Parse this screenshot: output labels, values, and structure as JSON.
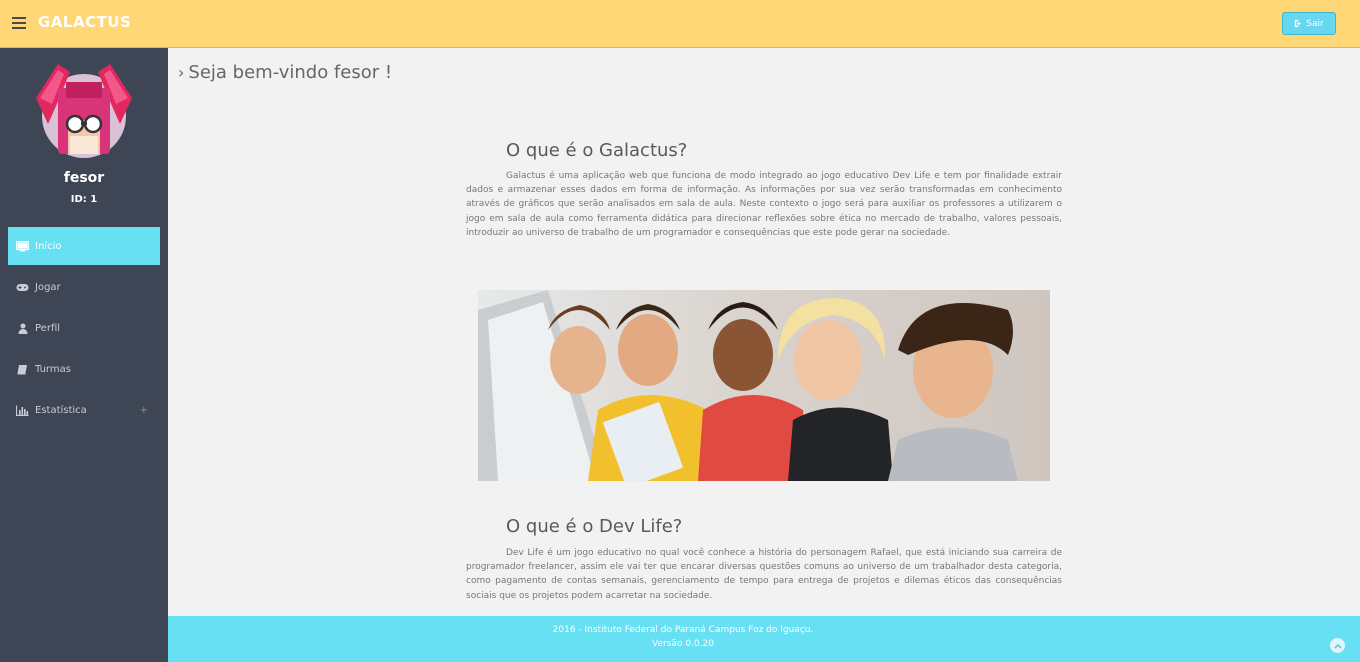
{
  "header": {
    "brand": "GALACTUS",
    "logout_label": "Sair",
    "accent": "#ffd776",
    "button_color": "#66d7ee"
  },
  "sidebar": {
    "username": "fesor",
    "user_id": "ID: 1",
    "items": [
      {
        "label": "Início",
        "icon": "monitor-icon",
        "active": true
      },
      {
        "label": "Jogar",
        "icon": "gamepad-icon"
      },
      {
        "label": "Perfil",
        "icon": "user-icon"
      },
      {
        "label": "Turmas",
        "icon": "book-icon"
      },
      {
        "label": "Estatística",
        "icon": "bar-chart-icon",
        "expand": "+"
      }
    ],
    "background": "#3e4555",
    "active_color": "#66e0f2"
  },
  "main": {
    "welcome": "Seja bem-vindo fesor !",
    "sections": [
      {
        "title": "O que é o Galactus?",
        "text": "Galactus é uma aplicação web que funciona de modo integrado ao jogo educativo Dev Life e tem por finalidade extrair dados e armazenar esses dados em forma de informação. As informações por sua vez serão transformadas em conhecimento através de gráficos que serão analisados em sala de aula. Neste contexto o jogo será para auxiliar os professores a utilizarem o jogo em sala de aula como ferramenta didática para direcionar reflexões sobre ética no mercado de trabalho, valores pessoais, introduzir ao universo de trabalho de um programador e consequências que este pode gerar na sociedade."
      },
      {
        "title": "O que é o Dev Life?",
        "text": "Dev Life é um jogo educativo no qual você conhece a história do personagem Rafael, que está iniciando sua carreira de programador freelancer, assim ele vai ter que encarar diversas questões comuns ao universo de um trabalhador desta categoria, como pagamento de contas semanais, gerenciamento de tempo para entrega de projetos e dilemas éticos das consequências sociais que os projetos podem acarretar na sociedade."
      }
    ]
  },
  "footer": {
    "line1": "2016 - Instituto Federal do Paraná Campus Foz do Iguaçu.",
    "line2": "Versão 0.0.20",
    "color": "#66e0f2"
  }
}
